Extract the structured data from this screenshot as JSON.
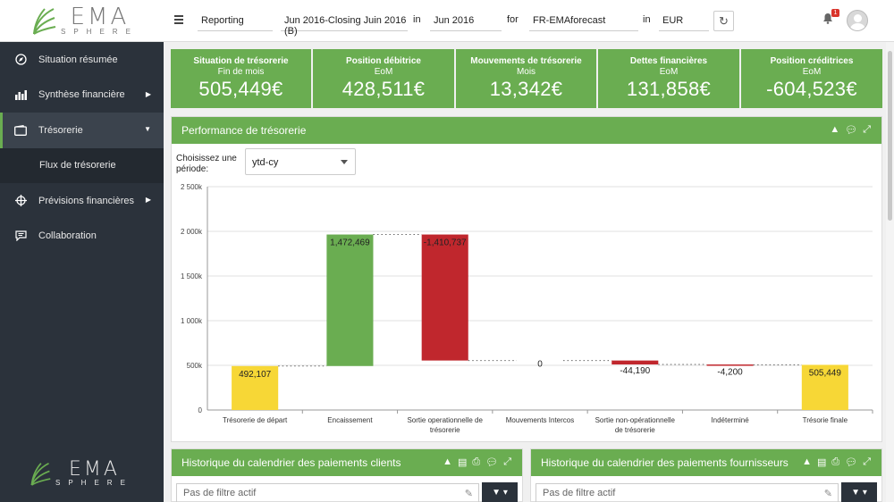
{
  "brand": {
    "name": "EMA",
    "tagline": "SPHERE"
  },
  "topbar": {
    "module": "Reporting",
    "version": "Jun 2016-Closing Juin 2016 (B)",
    "in1": "in",
    "period": "Jun 2016",
    "for": "for",
    "entity": "FR-EMAforecast",
    "in2": "in",
    "currency": "EUR",
    "notifications": "1"
  },
  "nav": {
    "items": [
      {
        "label": "Situation résumée",
        "icon": "compass-icon"
      },
      {
        "label": "Synthèse financière",
        "icon": "bar-chart-icon"
      },
      {
        "label": "Trésorerie",
        "icon": "wallet-icon"
      },
      {
        "label": "Flux de trésorerie"
      },
      {
        "label": "Prévisions financières",
        "icon": "crosshair-icon"
      },
      {
        "label": "Collaboration",
        "icon": "chat-icon"
      }
    ]
  },
  "kpis": [
    {
      "title": "Situation de trésorerie",
      "sub": "Fin de mois",
      "value": "505,449€"
    },
    {
      "title": "Position débitrice",
      "sub": "EoM",
      "value": "428,511€"
    },
    {
      "title": "Mouvements de trésorerie",
      "sub": "Mois",
      "value": "13,342€"
    },
    {
      "title": "Dettes financières",
      "sub": "EoM",
      "value": "131,858€"
    },
    {
      "title": "Position créditrices",
      "sub": "EoM",
      "value": "-604,523€"
    }
  ],
  "performance": {
    "title": "Performance de trésorerie",
    "period_label": "Choisissez une période:",
    "period_value": "ytd-cy"
  },
  "chart_data": {
    "type": "bar",
    "subtype": "waterfall",
    "categories": [
      "Trésorerie de départ",
      "Encaissement",
      "Sortie operationnelle de trésorerie",
      "Mouvements Intercos",
      "Sortie non-opérationnelle de trésorerie",
      "Indéterminé",
      "Trésorie finale"
    ],
    "values": [
      492107,
      1472469,
      -1410737,
      0,
      -44190,
      -4200,
      505449
    ],
    "labels": [
      "492,107",
      "1,472,469",
      "-1,410,737",
      "0",
      "-44,190",
      "-4,200",
      "505,449"
    ],
    "kinds": [
      "total",
      "delta",
      "delta",
      "delta",
      "delta",
      "delta",
      "total"
    ],
    "yticks": [
      0,
      500000,
      1000000,
      1500000,
      2000000,
      2500000
    ],
    "ytick_labels": [
      "0",
      "500k",
      "1 000k",
      "1 500k",
      "2 000k",
      "2 500k"
    ],
    "ylim": [
      0,
      2500000
    ],
    "colors": {
      "total": "#f7d736",
      "positive": "#6aad51",
      "negative": "#c0272d"
    },
    "grid": true
  },
  "bottom_panels": [
    {
      "title": "Historique du calendrier des paiements clients",
      "filter": "Pas de filtre actif"
    },
    {
      "title": "Historique du calendrier des paiements fournisseurs",
      "filter": "Pas de filtre actif"
    }
  ]
}
